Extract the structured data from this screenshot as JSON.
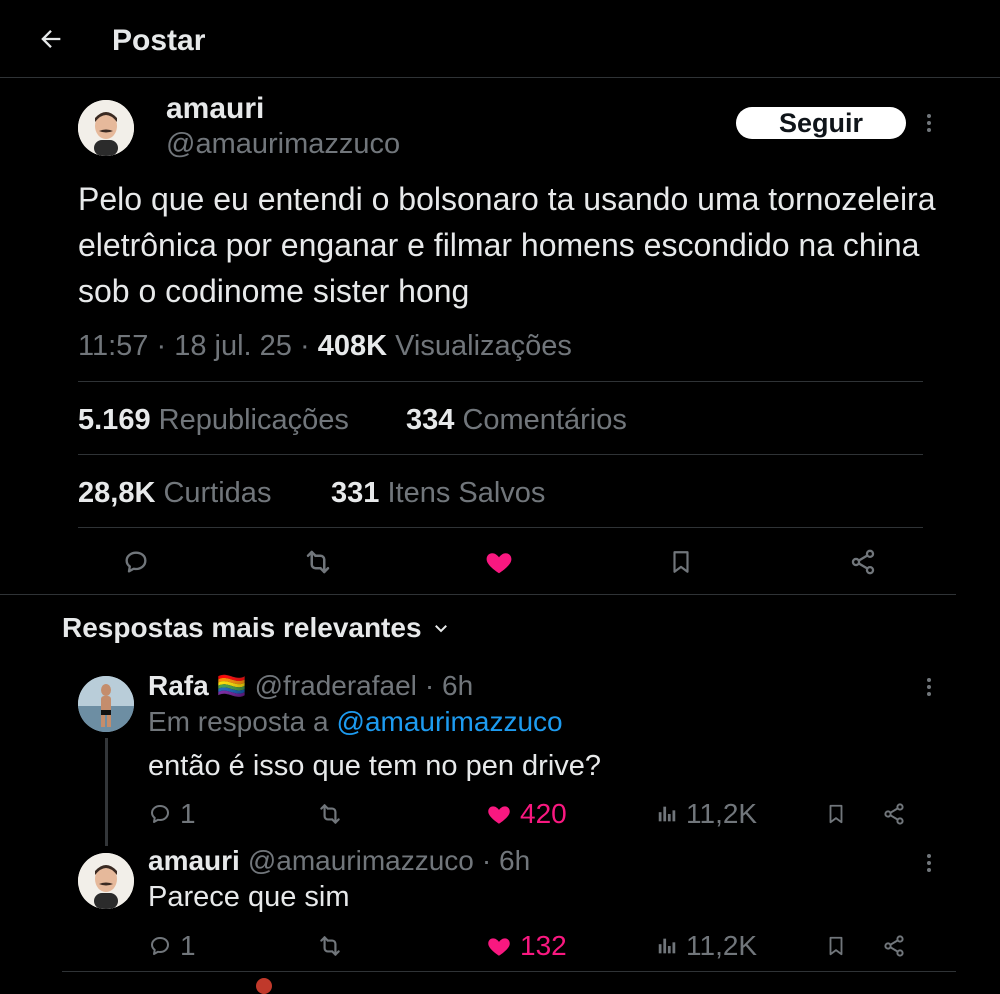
{
  "header": {
    "title": "Postar"
  },
  "post": {
    "author_name": "amauri",
    "author_handle": "@amaurimazzuco",
    "follow_label": "Seguir",
    "text": "Pelo que eu entendi o bolsonaro ta usando uma tornozeleira eletrônica por enganar e filmar homens escondido na china sob o codinome sister hong",
    "time": "11:57",
    "date": "18 jul. 25",
    "separator": "·",
    "views_count": "408K",
    "views_label": "Visualizações",
    "reposts_count": "5.169",
    "reposts_label": "Republicações",
    "comments_count": "334",
    "comments_label": "Comentários",
    "likes_count": "28,8K",
    "likes_label": "Curtidas",
    "saved_count": "331",
    "saved_label": "Itens Salvos",
    "liked": true
  },
  "replies_section": {
    "sort_label": "Respostas mais relevantes"
  },
  "replies": [
    {
      "name": "Rafa",
      "flag_emoji": "🏳️‍🌈",
      "handle": "@fraderafael",
      "age": "· 6h",
      "reply_to_label": "Em resposta a",
      "reply_to_handle": "@amaurimazzuco",
      "text": "então é isso que tem no pen drive?",
      "comments": "1",
      "likes": "420",
      "views": "11,2K"
    },
    {
      "name": "amauri",
      "handle": "@amaurimazzuco",
      "age": "· 6h",
      "text": "Parece que sim",
      "comments": "1",
      "likes": "132",
      "views": "11,2K"
    }
  ],
  "colors": {
    "accent": "#1d9bf0",
    "like": "#f91880",
    "background": "#000000",
    "muted": "#71767b"
  }
}
